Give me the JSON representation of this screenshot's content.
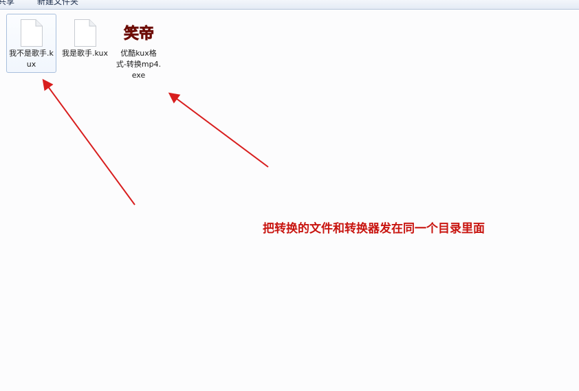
{
  "toolbar": {
    "items": [
      "共享",
      "新建文件夹"
    ]
  },
  "files": [
    {
      "name": "我不是歌手.kux",
      "icon": "blank-file-icon",
      "selected": true
    },
    {
      "name": "我是歌手.kux",
      "icon": "blank-file-icon",
      "selected": false
    },
    {
      "name": "优酷kux格式-转换mp4.exe",
      "icon": "xiaodi-app-icon",
      "icon_text": "笑帝",
      "selected": false
    }
  ],
  "annotation": {
    "text": "把转换的文件和转换器发在同一个目录里面",
    "color": "#c8140f"
  },
  "colors": {
    "arrow": "#d81e1e",
    "selection_border": "#a8bfdd"
  }
}
